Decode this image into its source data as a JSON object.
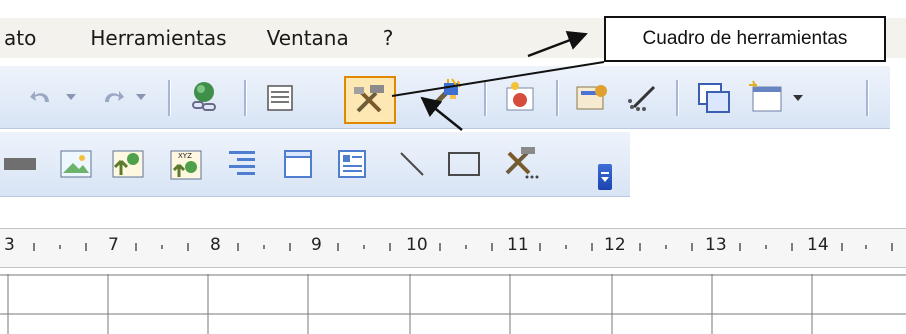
{
  "menu": {
    "items": [
      {
        "id": "formato",
        "label": "ato"
      },
      {
        "id": "herramientas",
        "label": "Herramientas"
      },
      {
        "id": "ventana",
        "label": "Ventana"
      },
      {
        "id": "ayuda",
        "label": "?"
      }
    ]
  },
  "toolbar_standard": {
    "buttons": [
      "undo-icon",
      "redo-icon",
      "hyperlink-icon",
      "document-map-icon",
      "drawing-toolbox-icon",
      "format-painter-icon",
      "insert-image-icon",
      "properties-icon",
      "magic-wand-icon",
      "window-copy-icon",
      "new-document-icon"
    ]
  },
  "toolbar_drawing": {
    "buttons": [
      "rectangle-filled-icon",
      "image-icon",
      "tree-image-icon",
      "xyz-image-icon",
      "vertical-align-icon",
      "frame-icon",
      "text-frame-icon",
      "line-icon",
      "rectangle-icon",
      "tools-icon"
    ]
  },
  "ruler": {
    "labels": [
      "3",
      "7",
      "8",
      "9",
      "10",
      "11",
      "12",
      "13",
      "14"
    ]
  },
  "callout": {
    "text": "Cuadro de herramientas"
  },
  "colors": {
    "menubar_bg": "#f3f2ec",
    "toolbar_bg": "#dfe8f6",
    "highlight_border": "#e18800",
    "highlight_fill": "#fde7b2"
  }
}
